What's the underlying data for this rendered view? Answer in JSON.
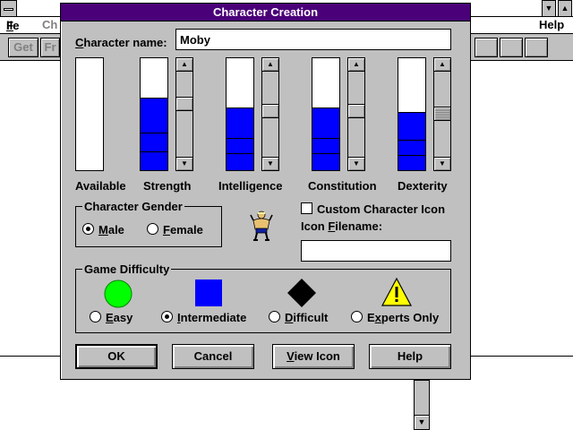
{
  "app": {
    "menu": {
      "file": "File",
      "partial": "Ch",
      "help": "Help"
    },
    "toolbar": {
      "get": "Get",
      "partial": "Fr"
    }
  },
  "dialog": {
    "title": "Character Creation",
    "name_label": "Character name:",
    "name_value": "Moby",
    "stats": [
      {
        "label": "Available",
        "level": 0.0,
        "has_scrollbar": false
      },
      {
        "label": "Strength",
        "level": 0.65,
        "has_scrollbar": true
      },
      {
        "label": "Intelligence",
        "level": 0.56,
        "has_scrollbar": true
      },
      {
        "label": "Constitution",
        "level": 0.56,
        "has_scrollbar": true
      },
      {
        "label": "Dexterity",
        "level": 0.52,
        "has_scrollbar": true
      }
    ],
    "gender": {
      "legend": "Character Gender",
      "options": [
        "Male",
        "Female"
      ],
      "selected": "Male"
    },
    "custom_icon": {
      "checkbox_label": "Custom Character Icon",
      "checked": false,
      "filename_label": "Icon Filename:",
      "filename_value": ""
    },
    "difficulty": {
      "legend": "Game Difficulty",
      "options": [
        {
          "label": "Easy",
          "icon": "green-circle-icon",
          "color": "#00ff00"
        },
        {
          "label": "Intermediate",
          "icon": "blue-square-icon",
          "color": "#0000ff"
        },
        {
          "label": "Difficult",
          "icon": "black-diamond-icon",
          "color": "#000000"
        },
        {
          "label": "Experts Only",
          "icon": "warning-triangle-icon",
          "color": "#ffff00"
        }
      ],
      "selected": "Intermediate"
    },
    "buttons": {
      "ok": "OK",
      "cancel": "Cancel",
      "view_icon": "View Icon",
      "help": "Help"
    }
  },
  "colors": {
    "title_bar": "#4a0078",
    "meter_fill": "#0000ff",
    "face": "#c0c0c0"
  }
}
